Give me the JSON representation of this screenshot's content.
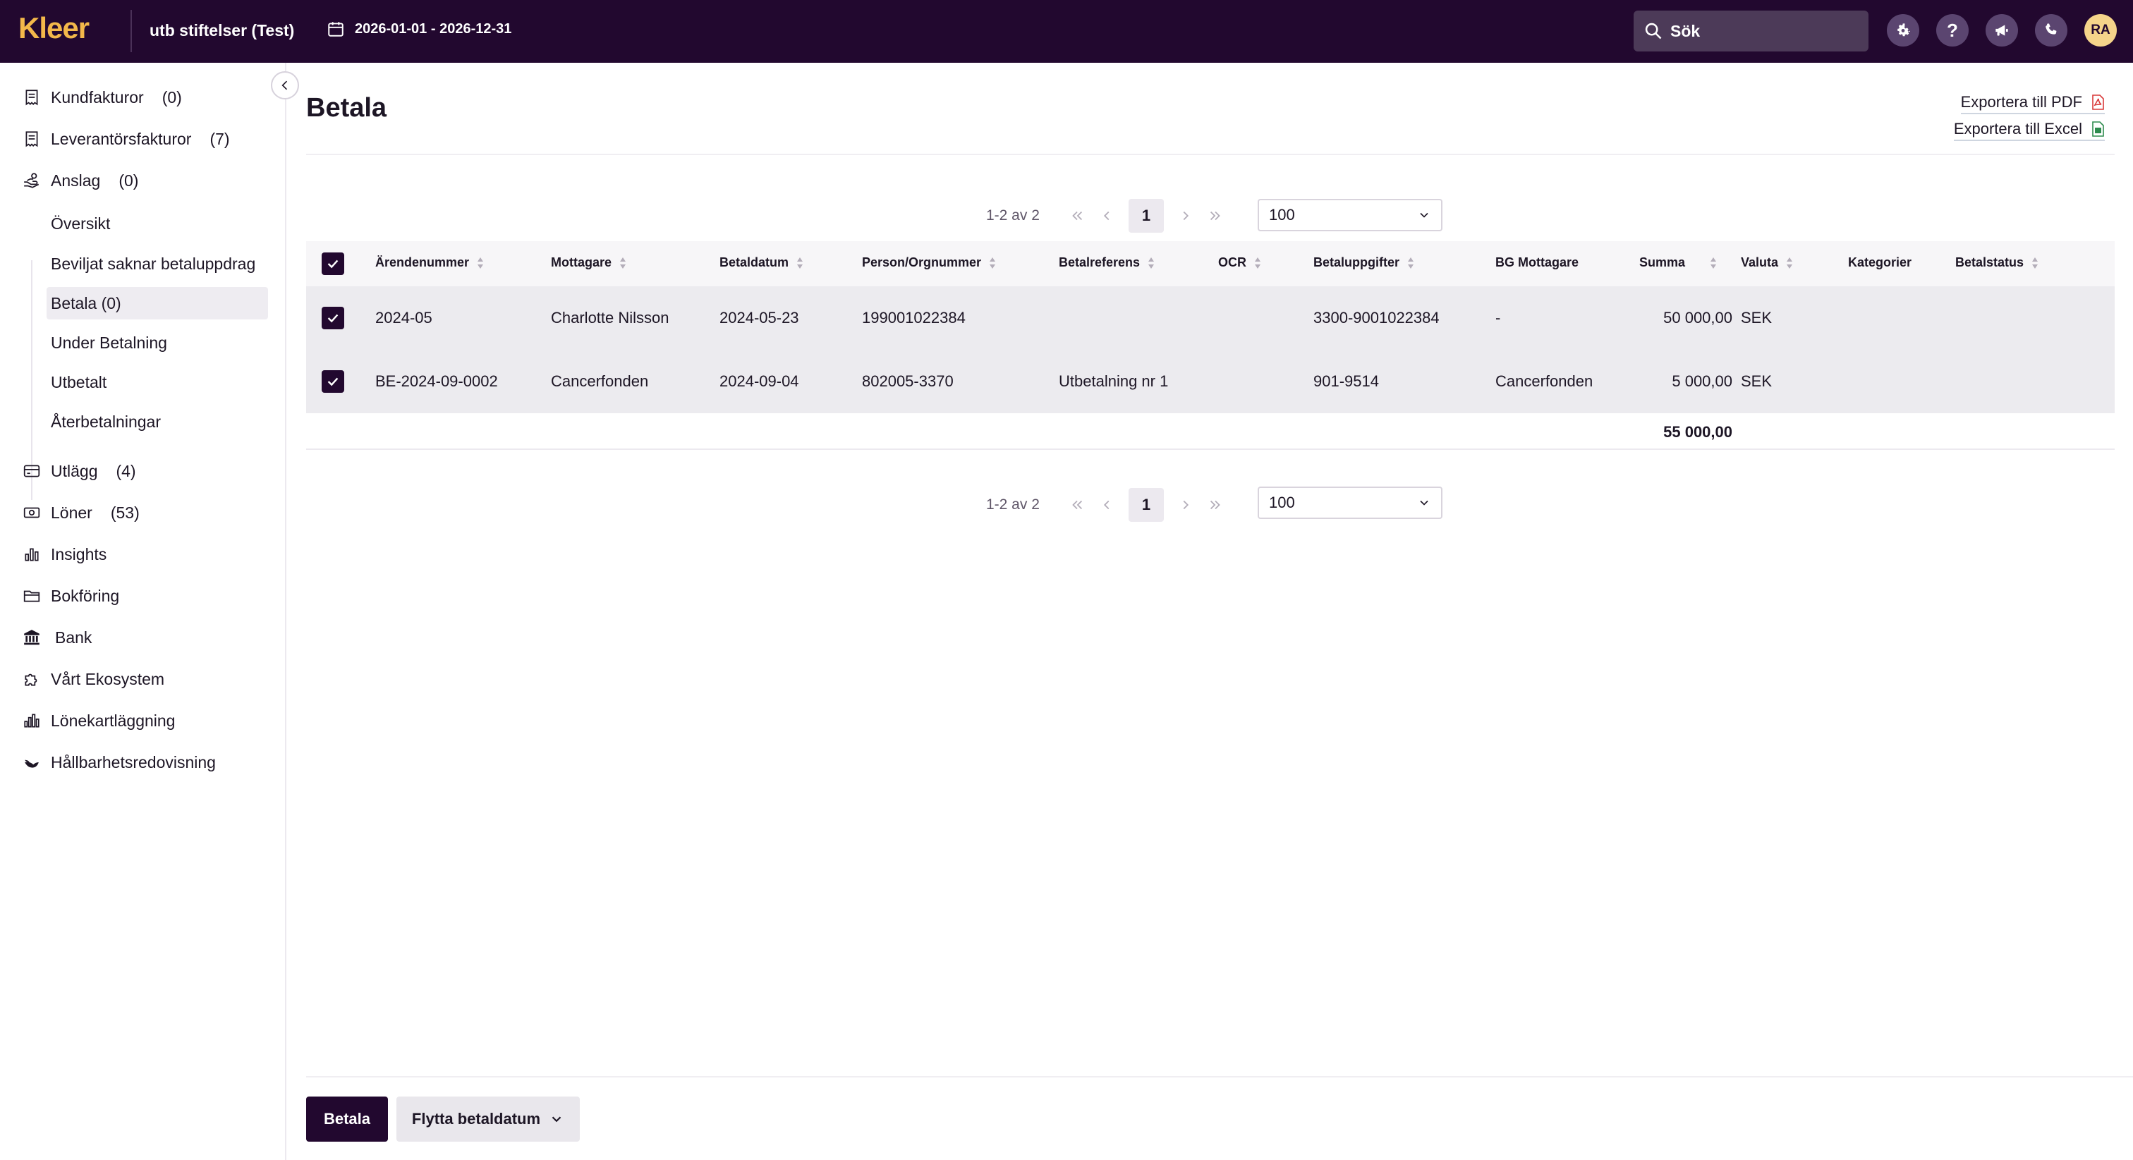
{
  "app": {
    "logo": "Kleer",
    "company": "utb stiftelser (Test)",
    "period": "2026-01-01 - 2026-12-31",
    "search_placeholder": "Sök",
    "avatar_initials": "RA",
    "brand_color": "#22082f",
    "logo_color": "#f3b84a"
  },
  "sidebar": {
    "items": [
      {
        "label": "Kundfakturor",
        "count": "(0)",
        "icon": "invoice-icon"
      },
      {
        "label": "Leverantörsfakturor",
        "count": "(7)",
        "icon": "invoice-icon"
      },
      {
        "label": "Anslag",
        "count": "(0)",
        "icon": "hand-coin-icon"
      },
      {
        "label": "Utlägg",
        "count": "(4)",
        "icon": "card-icon"
      },
      {
        "label": "Löner",
        "count": "(53)",
        "icon": "cash-icon"
      },
      {
        "label": "Insights",
        "count": "",
        "icon": "bar-chart-icon"
      },
      {
        "label": "Bokföring",
        "count": "",
        "icon": "folder-icon"
      },
      {
        "label": "Bank",
        "count": "",
        "icon": "bank-icon"
      },
      {
        "label": "Vårt Ekosystem",
        "count": "",
        "icon": "puzzle-icon"
      },
      {
        "label": "Lönekartläggning",
        "count": "",
        "icon": "bar-chart-icon"
      },
      {
        "label": "Hållbarhetsredovisning",
        "count": "",
        "icon": "leaf-icon"
      }
    ],
    "subitems": [
      {
        "label": "Översikt"
      },
      {
        "label": "Beviljat saknar betaluppdrag"
      },
      {
        "label": "Betala (0)",
        "active": true
      },
      {
        "label": "Under Betalning"
      },
      {
        "label": "Utbetalt"
      },
      {
        "label": "Återbetalningar"
      }
    ]
  },
  "main": {
    "title": "Betala",
    "export_pdf": "Exportera till PDF",
    "export_excel": "Exportera till Excel",
    "pager": {
      "info": "1-2 av 2",
      "page": "1",
      "page_size": "100"
    },
    "columns": [
      "Ärendenummer",
      "Mottagare",
      "Betaldatum",
      "Person/Orgnummer",
      "Betalreferens",
      "OCR",
      "Betaluppgifter",
      "BG Mottagare",
      "Summa",
      "Valuta",
      "Kategorier",
      "Betalstatus"
    ],
    "rows": [
      {
        "arende": "2024-05",
        "mottagare": "Charlotte Nilsson",
        "datum": "2024-05-23",
        "orgnr": "199001022384",
        "referens": "",
        "ocr": "",
        "uppgifter": "3300-9001022384",
        "bg": "-",
        "summa": "50 000,00",
        "valuta": "SEK",
        "kategorier": "",
        "status": "",
        "checked": true
      },
      {
        "arende": "BE-2024-09-0002",
        "mottagare": "Cancerfonden",
        "datum": "2024-09-04",
        "orgnr": "802005-3370",
        "referens": "Utbetalning nr 1",
        "ocr": "",
        "uppgifter": "901-9514",
        "bg": "Cancerfonden",
        "summa": "5 000,00",
        "valuta": "SEK",
        "kategorier": "",
        "status": "",
        "checked": true
      }
    ],
    "total": "55 000,00",
    "buttons": {
      "pay": "Betala",
      "move_date": "Flytta betaldatum"
    }
  }
}
